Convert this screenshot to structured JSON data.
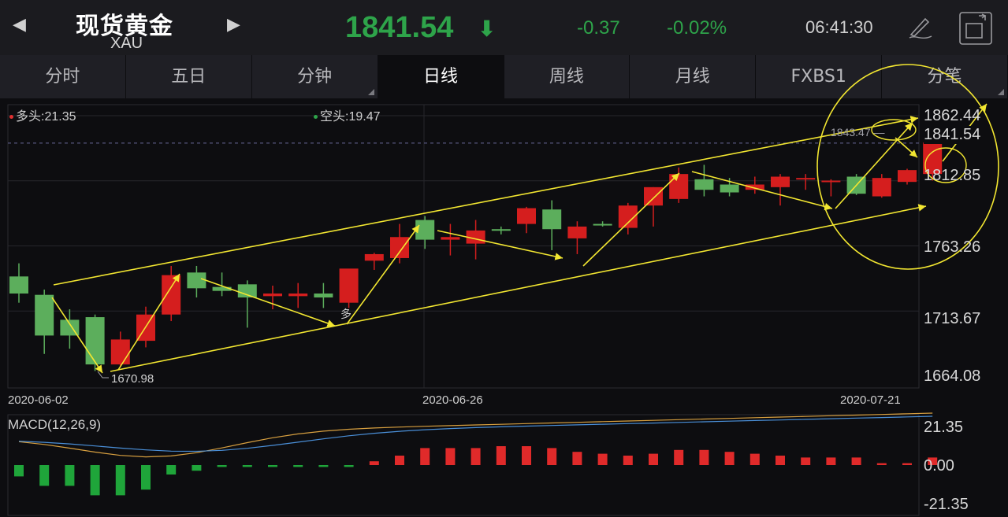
{
  "header": {
    "title": "现货黄金",
    "symbol": "XAU",
    "price": "1841.54",
    "change": "-0.37",
    "change_pct": "-0.02%",
    "time": "06:41:30",
    "price_color": "#2ea44a"
  },
  "tabs": [
    {
      "label": "分时"
    },
    {
      "label": "五日"
    },
    {
      "label": "分钟",
      "has_dropdown": true
    },
    {
      "label": "日线",
      "active": true
    },
    {
      "label": "周线"
    },
    {
      "label": "月线"
    },
    {
      "label": "FXBS1"
    },
    {
      "label": "分笔"
    }
  ],
  "legend": {
    "long": "多头:21.35",
    "short": "空头:19.47",
    "long_color": "#e03030",
    "short_color": "#2ea44a"
  },
  "annotations": {
    "high_label": "1843.47",
    "low_label": "1670.98",
    "char_label": "多"
  },
  "macd": {
    "title": "MACD(12,26,9)",
    "y_top": "21.35",
    "y_mid": "0.00",
    "y_bottom": "-21.35"
  },
  "chart_data": {
    "type": "candlestick",
    "x_labels": [
      "2020-06-02",
      "2020-06-26",
      "2020-07-21"
    ],
    "y_ticks": [
      "1862.44",
      "1812.85",
      "1763.26",
      "1713.67",
      "1664.08"
    ],
    "current_price_label": "1841.54",
    "ylim": [
      1664.08,
      1862.44
    ],
    "up_color": "#d51e1e",
    "down_color": "#5cae5c",
    "candles": [
      {
        "o": 1740,
        "h": 1750,
        "l": 1720,
        "c": 1727
      },
      {
        "o": 1726,
        "h": 1730,
        "l": 1681,
        "c": 1695
      },
      {
        "o": 1707,
        "h": 1715,
        "l": 1685,
        "c": 1695
      },
      {
        "o": 1709,
        "h": 1711,
        "l": 1668,
        "c": 1673
      },
      {
        "o": 1673,
        "h": 1698,
        "l": 1672,
        "c": 1692
      },
      {
        "o": 1691,
        "h": 1717,
        "l": 1686,
        "c": 1711
      },
      {
        "o": 1711,
        "h": 1748,
        "l": 1706,
        "c": 1741
      },
      {
        "o": 1743,
        "h": 1748,
        "l": 1724,
        "c": 1731
      },
      {
        "o": 1732,
        "h": 1743,
        "l": 1725,
        "c": 1729
      },
      {
        "o": 1734,
        "h": 1737,
        "l": 1701,
        "c": 1724
      },
      {
        "o": 1725,
        "h": 1733,
        "l": 1715,
        "c": 1727
      },
      {
        "o": 1725,
        "h": 1735,
        "l": 1716,
        "c": 1727
      },
      {
        "o": 1727,
        "h": 1735,
        "l": 1716,
        "c": 1724
      },
      {
        "o": 1720,
        "h": 1745,
        "l": 1716,
        "c": 1746
      },
      {
        "o": 1752,
        "h": 1758,
        "l": 1745,
        "c": 1757
      },
      {
        "o": 1754,
        "h": 1780,
        "l": 1750,
        "c": 1770
      },
      {
        "o": 1783,
        "h": 1786,
        "l": 1761,
        "c": 1768
      },
      {
        "o": 1768,
        "h": 1780,
        "l": 1756,
        "c": 1770
      },
      {
        "o": 1765,
        "h": 1783,
        "l": 1753,
        "c": 1775
      },
      {
        "o": 1776,
        "h": 1778,
        "l": 1772,
        "c": 1775
      },
      {
        "o": 1780,
        "h": 1793,
        "l": 1773,
        "c": 1792
      },
      {
        "o": 1791,
        "h": 1798,
        "l": 1760,
        "c": 1776
      },
      {
        "o": 1769,
        "h": 1782,
        "l": 1757,
        "c": 1778
      },
      {
        "o": 1780,
        "h": 1782,
        "l": 1778,
        "c": 1779
      },
      {
        "o": 1777,
        "h": 1796,
        "l": 1772,
        "c": 1794
      },
      {
        "o": 1794,
        "h": 1808,
        "l": 1778,
        "c": 1808
      },
      {
        "o": 1799,
        "h": 1823,
        "l": 1796,
        "c": 1818
      },
      {
        "o": 1814,
        "h": 1825,
        "l": 1801,
        "c": 1806
      },
      {
        "o": 1810,
        "h": 1815,
        "l": 1801,
        "c": 1804
      },
      {
        "o": 1806,
        "h": 1816,
        "l": 1803,
        "c": 1810
      },
      {
        "o": 1808,
        "h": 1818,
        "l": 1794,
        "c": 1816
      },
      {
        "o": 1815,
        "h": 1818,
        "l": 1806,
        "c": 1815
      },
      {
        "o": 1812,
        "h": 1814,
        "l": 1801,
        "c": 1813
      },
      {
        "o": 1816,
        "h": 1818,
        "l": 1802,
        "c": 1803
      },
      {
        "o": 1801,
        "h": 1818,
        "l": 1800,
        "c": 1815
      },
      {
        "o": 1812,
        "h": 1822,
        "l": 1810,
        "c": 1821
      },
      {
        "o": 1818,
        "h": 1845,
        "l": 1813,
        "c": 1842
      }
    ],
    "macd_bars": [
      -6,
      -11,
      -11,
      -16,
      -16,
      -13,
      -5,
      -3,
      -1,
      -1,
      -1,
      -1,
      -1,
      -1,
      2,
      5,
      9,
      9,
      9,
      10,
      10,
      9,
      7,
      6,
      5,
      6,
      8,
      8,
      7,
      6,
      5,
      4,
      4,
      4,
      1,
      1,
      4
    ]
  }
}
